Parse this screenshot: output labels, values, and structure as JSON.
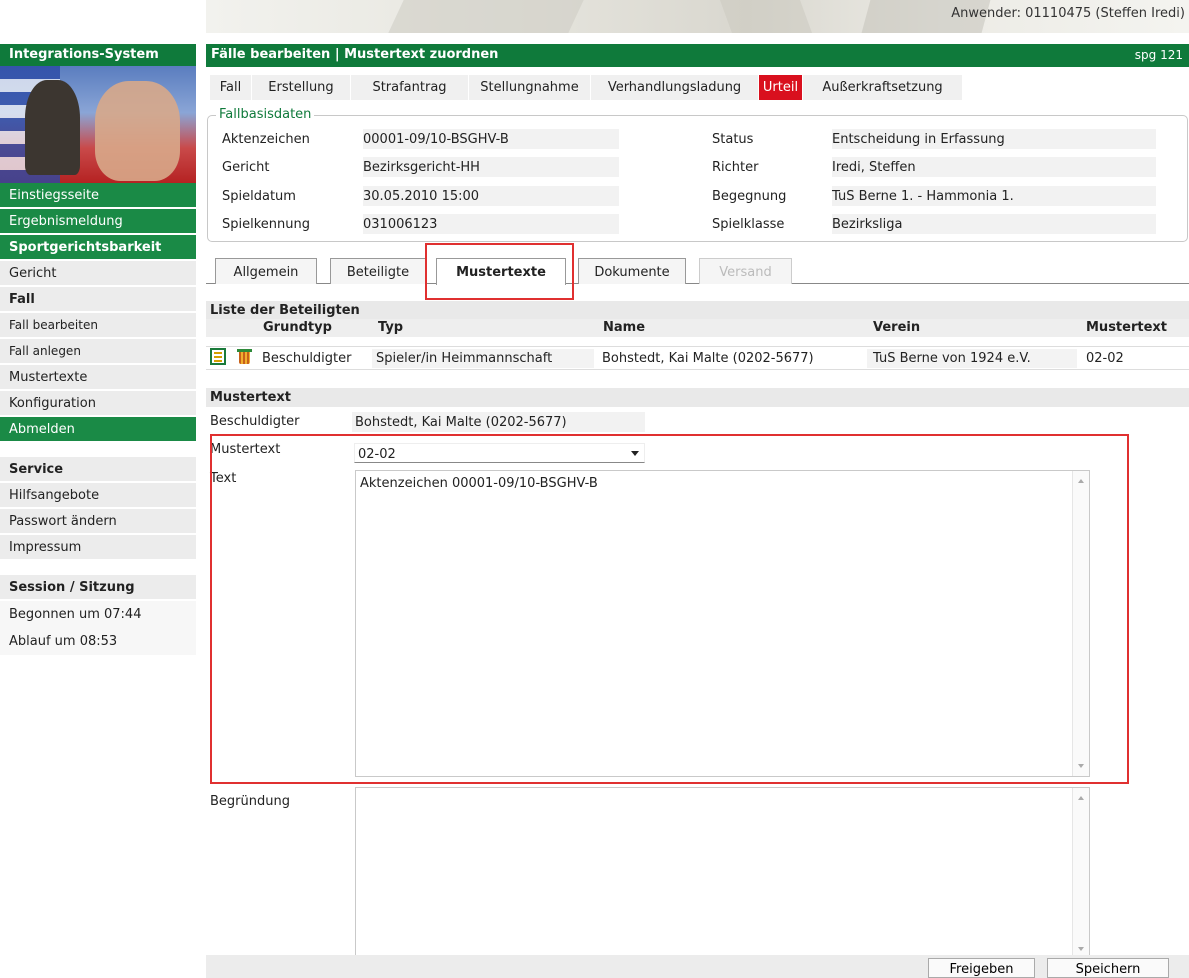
{
  "header": {
    "user_info": "Anwender: 01110475 (Steffen Iredi)"
  },
  "sidebar": {
    "system_title": "Integrations-System",
    "items": [
      {
        "label": "Einstiegsseite"
      },
      {
        "label": "Ergebnismeldung"
      },
      {
        "label": "Sportgerichtsbarkeit"
      },
      {
        "label": "Gericht"
      },
      {
        "label": "Fall"
      },
      {
        "label": "Fall bearbeiten"
      },
      {
        "label": "Fall anlegen"
      },
      {
        "label": "Mustertexte"
      },
      {
        "label": "Konfiguration"
      },
      {
        "label": "Abmelden"
      }
    ],
    "service": {
      "title": "Service",
      "items": [
        {
          "label": "Hilfsangebote"
        },
        {
          "label": "Passwort ändern"
        },
        {
          "label": "Impressum"
        }
      ]
    },
    "session": {
      "title": "Session / Sitzung",
      "started": "Begonnen um 07:44",
      "expires": "Ablauf um 08:53"
    }
  },
  "main": {
    "title": "Fälle bearbeiten | Mustertext zuordnen",
    "page_code": "spg 121",
    "tabs": [
      {
        "label": "Fall"
      },
      {
        "label": "Erstellung"
      },
      {
        "label": "Strafantrag"
      },
      {
        "label": "Stellungnahme"
      },
      {
        "label": "Verhandlungsladung"
      },
      {
        "label": "Urteil",
        "active": true
      },
      {
        "label": "Außerkraftsetzung"
      }
    ],
    "fallbasis": {
      "legend": "Fallbasisdaten",
      "left": [
        {
          "label": "Aktenzeichen",
          "value": "00001-09/10-BSGHV-B"
        },
        {
          "label": "Gericht",
          "value": "Bezirksgericht-HH"
        },
        {
          "label": "Spieldatum",
          "value": "30.05.2010 15:00"
        },
        {
          "label": "Spielkennung",
          "value": "031006123"
        }
      ],
      "right": [
        {
          "label": "Status",
          "value": "Entscheidung in Erfassung"
        },
        {
          "label": "Richter",
          "value": "Iredi, Steffen"
        },
        {
          "label": "Begegnung",
          "value": "TuS Berne 1. - Hammonia 1."
        },
        {
          "label": "Spielklasse",
          "value": "Bezirksliga"
        }
      ]
    },
    "subtabs": [
      {
        "label": "Allgemein"
      },
      {
        "label": "Beteiligte"
      },
      {
        "label": "Mustertexte",
        "active": true
      },
      {
        "label": "Dokumente"
      },
      {
        "label": "Versand",
        "disabled": true
      }
    ],
    "beteiligte": {
      "title": "Liste der Beteiligten",
      "columns": [
        "Grundtyp",
        "Typ",
        "Name",
        "Verein",
        "Mustertext"
      ],
      "rows": [
        {
          "grundtyp": "Beschuldigter",
          "typ": "Spieler/in Heimmannschaft",
          "name": "Bohstedt, Kai Malte (0202-5677)",
          "verein": "TuS Berne von 1924 e.V.",
          "mustertext": "02-02"
        }
      ]
    },
    "mustertext": {
      "title": "Mustertext",
      "beschuldigter_label": "Beschuldigter",
      "beschuldigter_value": "Bohstedt, Kai Malte  (0202-5677)",
      "mustertext_label": "Mustertext",
      "mustertext_value": "02-02",
      "text_label": "Text",
      "text_value": "Aktenzeichen 00001-09/10-BSGHV-B",
      "begruendung_label": "Begründung",
      "begruendung_value": ""
    },
    "buttons": {
      "freigeben": "Freigeben",
      "speichern": "Speichern"
    }
  },
  "colors": {
    "green": "#0f7a3b",
    "active_tab_red": "#d9101e",
    "highlight_red": "#e03030"
  }
}
